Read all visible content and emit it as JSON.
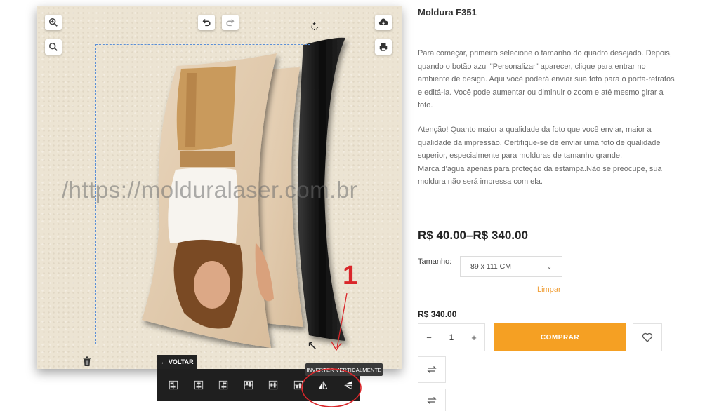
{
  "designer": {
    "watermark_text": "/https://molduralaser.com.br",
    "tools": {
      "zoom_in": "zoom-in-icon",
      "zoom_out": "zoom-out-icon",
      "undo": "undo-icon",
      "redo": "redo-icon",
      "download": "cloud-download-icon",
      "print": "print-icon",
      "rotate": "rotate-icon",
      "delete": "trash-icon"
    },
    "back_label": "← VOLTAR",
    "tooltip": "INVERTER VERTICALMENTE",
    "annotation_number": "1",
    "colors": {
      "selection": "#5b8fd6",
      "annotation": "#d9262a",
      "toolbar": "#1f1f1f"
    }
  },
  "product": {
    "title": "Moldura F351",
    "description_1": "Para começar, primeiro selecione o tamanho do quadro desejado. Depois, quando o botão azul \"Personalizar\" aparecer, clique para entrar no ambiente de design. Aqui você poderá enviar sua foto para o porta-retratos e editá-la. Você pode aumentar ou diminuir o zoom e até mesmo girar a foto.",
    "description_2": "Atenção! Quanto maior a qualidade da foto que você enviar, maior a qualidade da impressão. Certifique-se de enviar uma foto de qualidade superior, especialmente para molduras de tamanho grande.",
    "description_3": "Marca d'água apenas para proteção da estampa.Não se preocupe, sua moldura não será impressa com ela.",
    "price_range": "R$ 40.00–R$ 340.00",
    "size_label": "Tamanho:",
    "size_value": "89 x 111 CM",
    "clear_label": "Limpar",
    "variation_price": "R$ 340.00",
    "quantity": "1",
    "minus": "−",
    "plus": "+",
    "buy_label": "COMPRAR",
    "accent_color": "#f5a023"
  }
}
